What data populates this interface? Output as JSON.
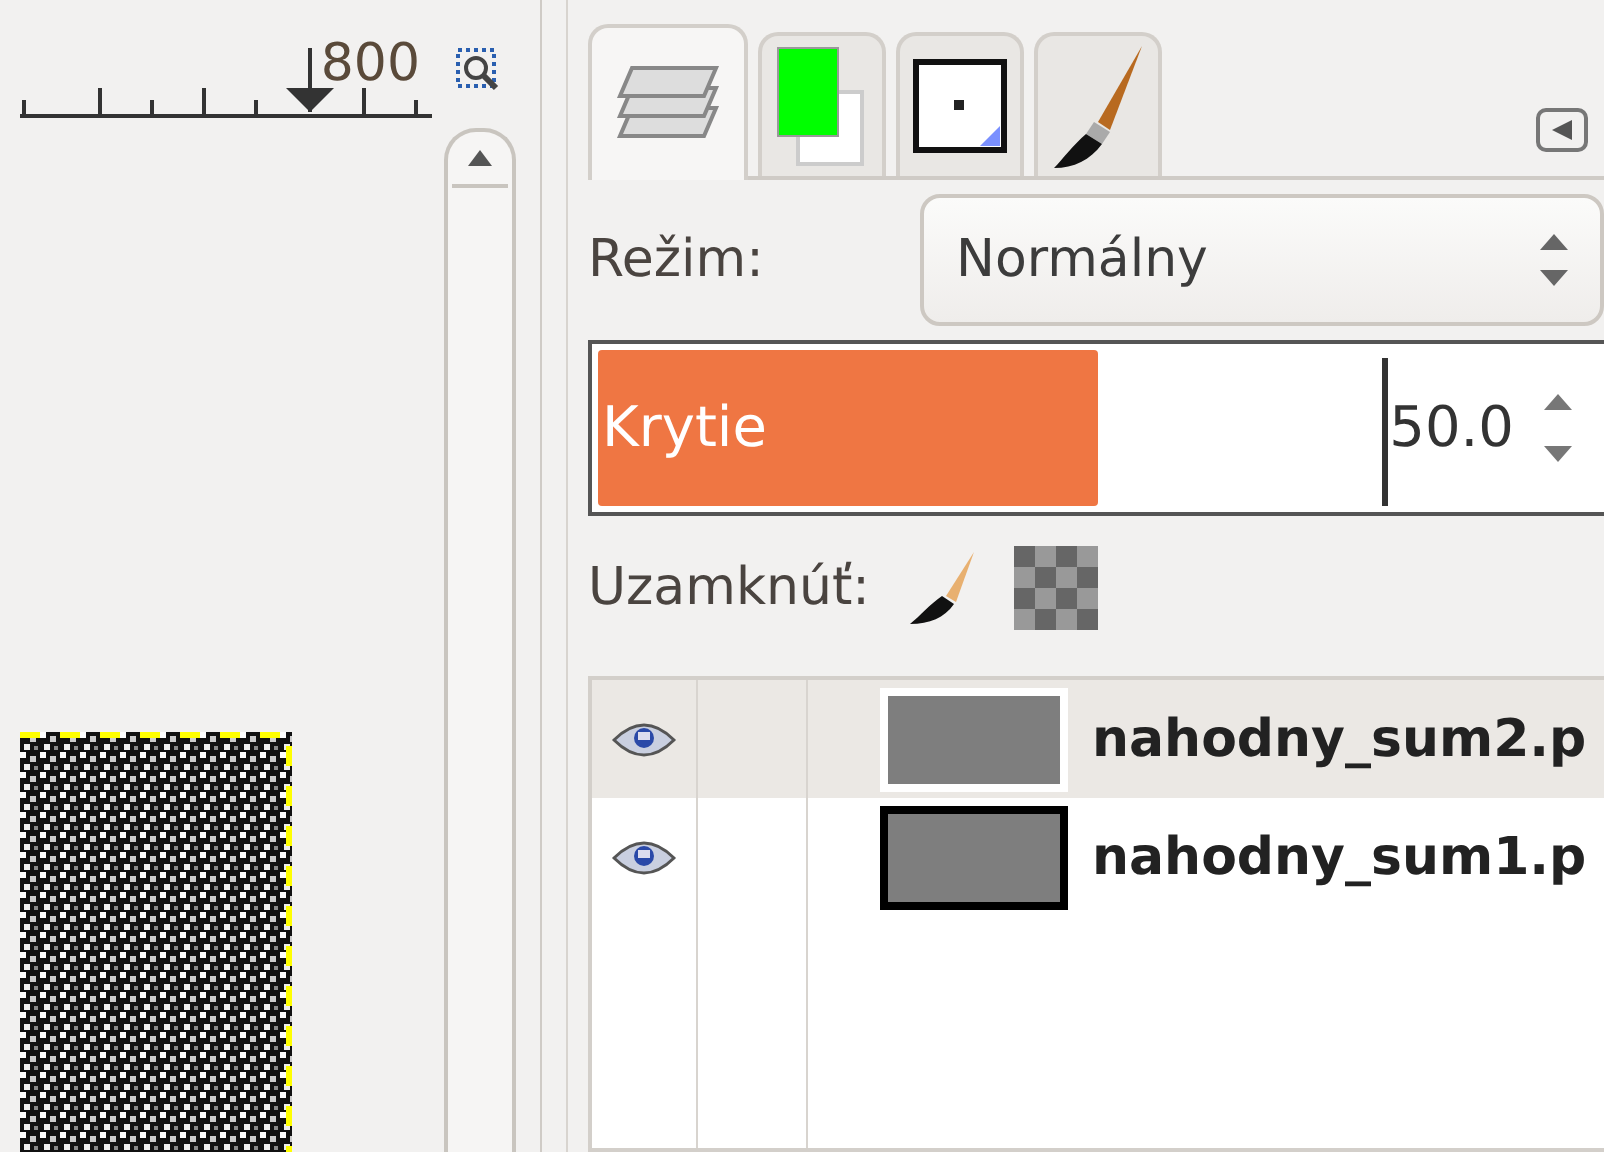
{
  "ruler": {
    "label": "800"
  },
  "tabs": [
    {
      "kind": "layers",
      "selected": true
    },
    {
      "kind": "colors",
      "selected": false
    },
    {
      "kind": "brush",
      "selected": false
    },
    {
      "kind": "paintbrush",
      "selected": false
    }
  ],
  "mode": {
    "label": "Režim:",
    "value": "Normálny"
  },
  "opacity": {
    "label": "Krytie",
    "value": "50.0",
    "level": 0.5
  },
  "lock": {
    "label": "Uzamknúť:"
  },
  "layers": [
    {
      "name": "nahodny_sum2.p",
      "visible": true,
      "selected": true,
      "outlined": false
    },
    {
      "name": "nahodny_sum1.p",
      "visible": true,
      "selected": false,
      "outlined": true
    }
  ]
}
